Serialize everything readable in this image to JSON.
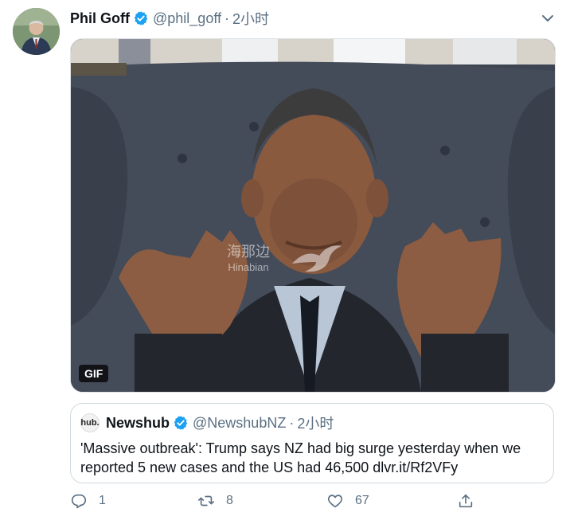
{
  "tweet": {
    "author_name": "Phil Goff",
    "author_handle": "@phil_goff",
    "separator": "·",
    "time": "2小时",
    "media": {
      "badge": "GIF",
      "watermark_cn": "海那边",
      "watermark_en": "Hinabian"
    },
    "quoted": {
      "logo_text": "hub.",
      "name": "Newshub",
      "handle": "@NewshubNZ",
      "separator": "·",
      "time": "2小时",
      "text": "'Massive outbreak': Trump says NZ had big surge yesterday when we reported 5 new cases and the US had 46,500 dlvr.it/Rf2VFy"
    },
    "actions": {
      "reply_count": "1",
      "retweet_count": "8",
      "like_count": "67"
    }
  },
  "colors": {
    "accent": "#1da1f2",
    "secondary_text": "#5b7083",
    "border": "#cfd9de"
  },
  "icons": [
    "verified-icon",
    "chevron-down-icon",
    "reply-icon",
    "retweet-icon",
    "like-icon",
    "share-icon"
  ]
}
